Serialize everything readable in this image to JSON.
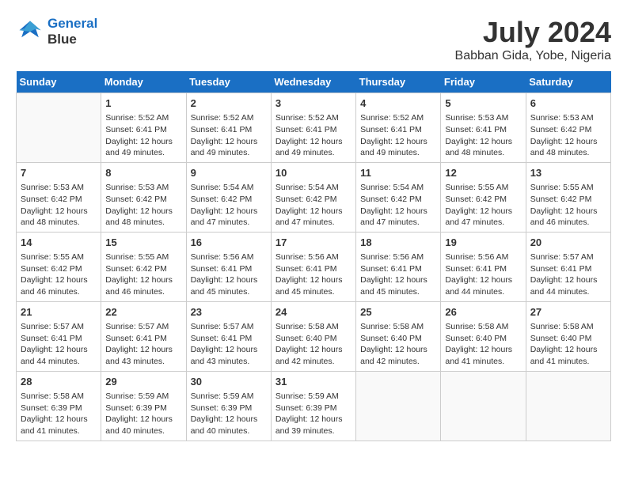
{
  "header": {
    "logo_line1": "General",
    "logo_line2": "Blue",
    "month": "July 2024",
    "location": "Babban Gida, Yobe, Nigeria"
  },
  "weekdays": [
    "Sunday",
    "Monday",
    "Tuesday",
    "Wednesday",
    "Thursday",
    "Friday",
    "Saturday"
  ],
  "weeks": [
    [
      {
        "day": "",
        "info": ""
      },
      {
        "day": "1",
        "info": "Sunrise: 5:52 AM\nSunset: 6:41 PM\nDaylight: 12 hours\nand 49 minutes."
      },
      {
        "day": "2",
        "info": "Sunrise: 5:52 AM\nSunset: 6:41 PM\nDaylight: 12 hours\nand 49 minutes."
      },
      {
        "day": "3",
        "info": "Sunrise: 5:52 AM\nSunset: 6:41 PM\nDaylight: 12 hours\nand 49 minutes."
      },
      {
        "day": "4",
        "info": "Sunrise: 5:52 AM\nSunset: 6:41 PM\nDaylight: 12 hours\nand 49 minutes."
      },
      {
        "day": "5",
        "info": "Sunrise: 5:53 AM\nSunset: 6:41 PM\nDaylight: 12 hours\nand 48 minutes."
      },
      {
        "day": "6",
        "info": "Sunrise: 5:53 AM\nSunset: 6:42 PM\nDaylight: 12 hours\nand 48 minutes."
      }
    ],
    [
      {
        "day": "7",
        "info": "Sunrise: 5:53 AM\nSunset: 6:42 PM\nDaylight: 12 hours\nand 48 minutes."
      },
      {
        "day": "8",
        "info": "Sunrise: 5:53 AM\nSunset: 6:42 PM\nDaylight: 12 hours\nand 48 minutes."
      },
      {
        "day": "9",
        "info": "Sunrise: 5:54 AM\nSunset: 6:42 PM\nDaylight: 12 hours\nand 47 minutes."
      },
      {
        "day": "10",
        "info": "Sunrise: 5:54 AM\nSunset: 6:42 PM\nDaylight: 12 hours\nand 47 minutes."
      },
      {
        "day": "11",
        "info": "Sunrise: 5:54 AM\nSunset: 6:42 PM\nDaylight: 12 hours\nand 47 minutes."
      },
      {
        "day": "12",
        "info": "Sunrise: 5:55 AM\nSunset: 6:42 PM\nDaylight: 12 hours\nand 47 minutes."
      },
      {
        "day": "13",
        "info": "Sunrise: 5:55 AM\nSunset: 6:42 PM\nDaylight: 12 hours\nand 46 minutes."
      }
    ],
    [
      {
        "day": "14",
        "info": "Sunrise: 5:55 AM\nSunset: 6:42 PM\nDaylight: 12 hours\nand 46 minutes."
      },
      {
        "day": "15",
        "info": "Sunrise: 5:55 AM\nSunset: 6:42 PM\nDaylight: 12 hours\nand 46 minutes."
      },
      {
        "day": "16",
        "info": "Sunrise: 5:56 AM\nSunset: 6:41 PM\nDaylight: 12 hours\nand 45 minutes."
      },
      {
        "day": "17",
        "info": "Sunrise: 5:56 AM\nSunset: 6:41 PM\nDaylight: 12 hours\nand 45 minutes."
      },
      {
        "day": "18",
        "info": "Sunrise: 5:56 AM\nSunset: 6:41 PM\nDaylight: 12 hours\nand 45 minutes."
      },
      {
        "day": "19",
        "info": "Sunrise: 5:56 AM\nSunset: 6:41 PM\nDaylight: 12 hours\nand 44 minutes."
      },
      {
        "day": "20",
        "info": "Sunrise: 5:57 AM\nSunset: 6:41 PM\nDaylight: 12 hours\nand 44 minutes."
      }
    ],
    [
      {
        "day": "21",
        "info": "Sunrise: 5:57 AM\nSunset: 6:41 PM\nDaylight: 12 hours\nand 44 minutes."
      },
      {
        "day": "22",
        "info": "Sunrise: 5:57 AM\nSunset: 6:41 PM\nDaylight: 12 hours\nand 43 minutes."
      },
      {
        "day": "23",
        "info": "Sunrise: 5:57 AM\nSunset: 6:41 PM\nDaylight: 12 hours\nand 43 minutes."
      },
      {
        "day": "24",
        "info": "Sunrise: 5:58 AM\nSunset: 6:40 PM\nDaylight: 12 hours\nand 42 minutes."
      },
      {
        "day": "25",
        "info": "Sunrise: 5:58 AM\nSunset: 6:40 PM\nDaylight: 12 hours\nand 42 minutes."
      },
      {
        "day": "26",
        "info": "Sunrise: 5:58 AM\nSunset: 6:40 PM\nDaylight: 12 hours\nand 41 minutes."
      },
      {
        "day": "27",
        "info": "Sunrise: 5:58 AM\nSunset: 6:40 PM\nDaylight: 12 hours\nand 41 minutes."
      }
    ],
    [
      {
        "day": "28",
        "info": "Sunrise: 5:58 AM\nSunset: 6:39 PM\nDaylight: 12 hours\nand 41 minutes."
      },
      {
        "day": "29",
        "info": "Sunrise: 5:59 AM\nSunset: 6:39 PM\nDaylight: 12 hours\nand 40 minutes."
      },
      {
        "day": "30",
        "info": "Sunrise: 5:59 AM\nSunset: 6:39 PM\nDaylight: 12 hours\nand 40 minutes."
      },
      {
        "day": "31",
        "info": "Sunrise: 5:59 AM\nSunset: 6:39 PM\nDaylight: 12 hours\nand 39 minutes."
      },
      {
        "day": "",
        "info": ""
      },
      {
        "day": "",
        "info": ""
      },
      {
        "day": "",
        "info": ""
      }
    ]
  ]
}
